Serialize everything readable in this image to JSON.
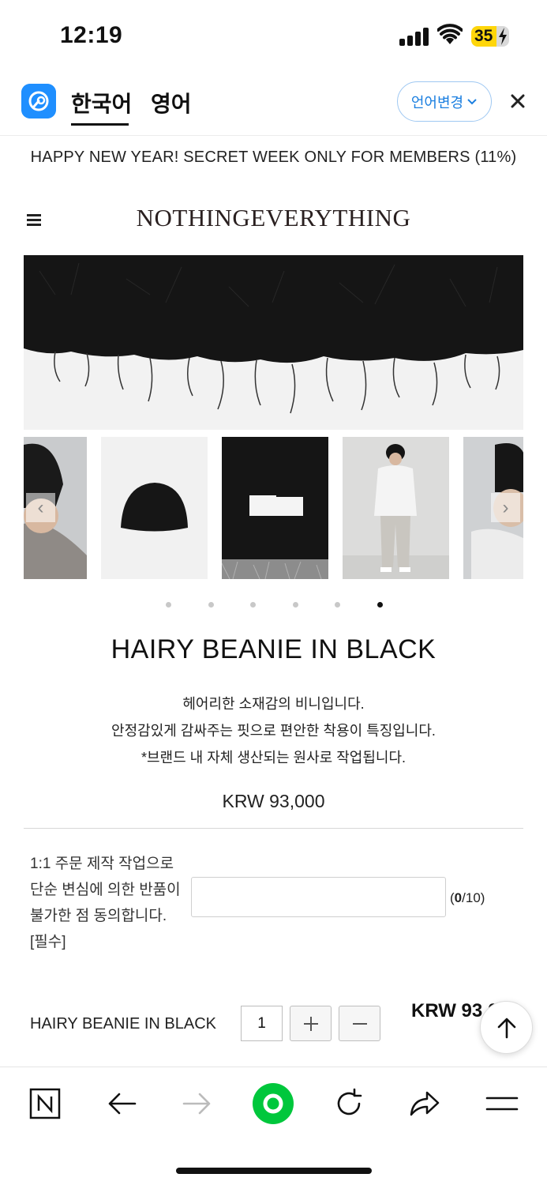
{
  "status_bar": {
    "time": "12:19",
    "battery": "35"
  },
  "translate_bar": {
    "tab_korean": "한국어",
    "tab_english": "영어",
    "change_language": "언어변경"
  },
  "banner": "HAPPY NEW YEAR! SECRET WEEK ONLY FOR MEMBERS (11%)",
  "brand": "NOTHINGEVERYTHING",
  "gallery": {
    "prev": "‹",
    "next": "›",
    "dot_count": 6,
    "active_dot_index": 5
  },
  "product": {
    "title": "HAIRY BEANIE IN BLACK",
    "description": [
      "헤어리한 소재감의 비니입니다.",
      "안정감있게 감싸주는 핏으로 편안한 착용이 특징입니다.",
      "*브랜드 내 자체 생산되는 원사로 작업됩니다."
    ],
    "price": "KRW 93,000"
  },
  "custom_option": {
    "notice_lines": [
      "1:1 주문 제작 작업으로",
      "단순 변심에 의한 반품이",
      "불가한 점 동의합니다.",
      "[필수]"
    ],
    "input_value": "",
    "counter_current": "0",
    "counter_max": "/10)",
    "counter_open": "("
  },
  "selected_option": {
    "name": "HAIRY BEANIE IN BLACK",
    "quantity": "1",
    "line_price": "KRW 93,0"
  },
  "colors": {
    "accent": "#1b7fe0",
    "browser_green": "#00c73c",
    "text": "#111111"
  },
  "icons": {
    "bottom_bar": [
      "naver-home-icon",
      "back-arrow-icon",
      "forward-arrow-icon",
      "green-dot-icon",
      "refresh-icon",
      "share-icon",
      "menu-lines-icon"
    ]
  }
}
